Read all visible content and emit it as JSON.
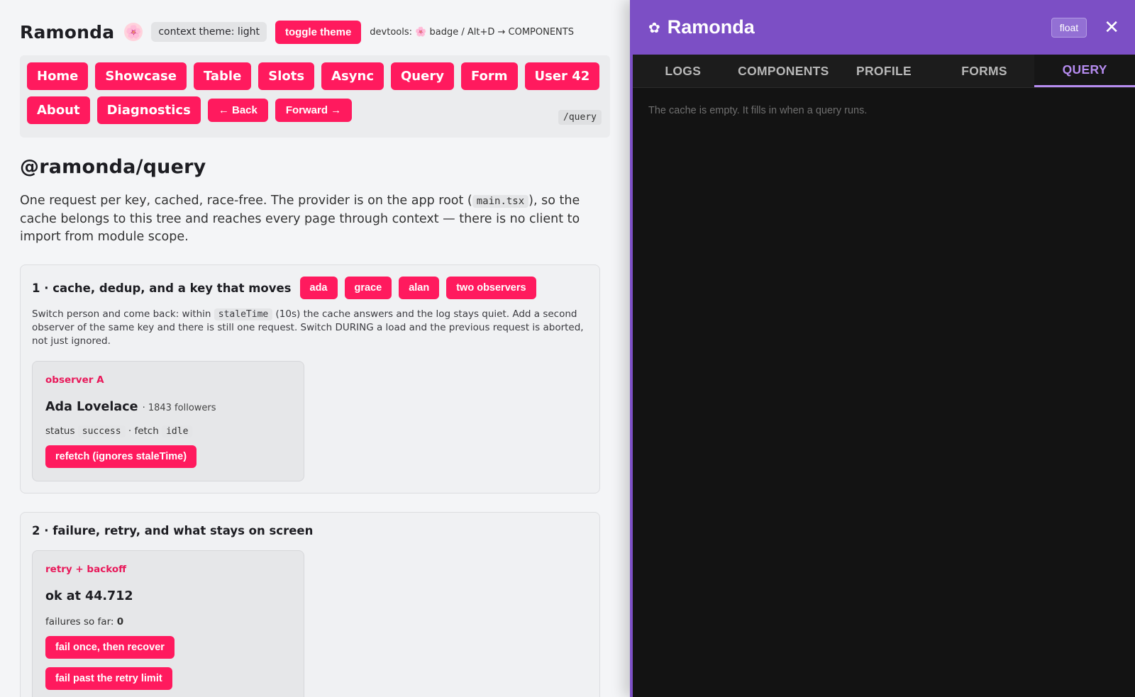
{
  "app": {
    "brand": "Ramonda",
    "flower_icon": "🌸",
    "theme_pill": "context theme: light",
    "toggle_theme": "toggle theme",
    "devtools_hint_prefix": "devtools:",
    "devtools_hint_flower": "🌸",
    "devtools_hint_suffix": "badge / Alt+D → COMPONENTS"
  },
  "nav": {
    "row1": [
      "Home",
      "Showcase",
      "Table",
      "Slots",
      "Async",
      "Query",
      "Form",
      "User 42"
    ],
    "row2": [
      "About",
      "Diagnostics"
    ],
    "back": "← Back",
    "forward": "Forward →",
    "route": "/query"
  },
  "page": {
    "title": "@ramonda/query",
    "lead_part1": "One request per key, cached, race-free. The provider is on the app root (",
    "lead_code": "main.tsx",
    "lead_part2": "), so the cache belongs to this tree and reaches every page through context — there is no client to import from module scope."
  },
  "section1": {
    "title": "1 · cache, dedup, and a key that moves",
    "chips": [
      "ada",
      "grace",
      "alan",
      "two observers"
    ],
    "desc_part1": "Switch person and come back: within",
    "desc_code": "staleTime",
    "desc_part2": "(10s) the cache answers and the log stays quiet. Add a second observer of the same key and there is still one request. Switch DURING a load and the previous request is aborted, not just ignored.",
    "observer": {
      "label": "observer A",
      "name": "Ada Lovelace",
      "meta": "· 1843 followers",
      "status_label": "status",
      "status_value": "success",
      "fetch_label": "· fetch",
      "fetch_value": "idle",
      "refetch_button": "refetch (ignores staleTime)"
    }
  },
  "section2": {
    "title": "2 · failure, retry, and what stays on screen",
    "box": {
      "label": "retry + backoff",
      "result": "ok at 44.712",
      "failures_label": "failures so far:",
      "failures_value": "0",
      "buttons": [
        "fail once, then recover",
        "fail past the retry limit"
      ]
    }
  },
  "devtools": {
    "logo_icon": "✿",
    "title": "Ramonda",
    "float_button": "float",
    "close_icon": "✕",
    "tabs": [
      "LOGS",
      "COMPONENTS",
      "PROFILE",
      "FORMS",
      "QUERY"
    ],
    "active_tab": "QUERY",
    "empty_message": "The cache is empty. It fills in when a query runs."
  },
  "colors": {
    "accent_pink": "#ff1a5e",
    "devtools_purple": "#7c4fc5",
    "active_tab": "#b68cf0"
  }
}
